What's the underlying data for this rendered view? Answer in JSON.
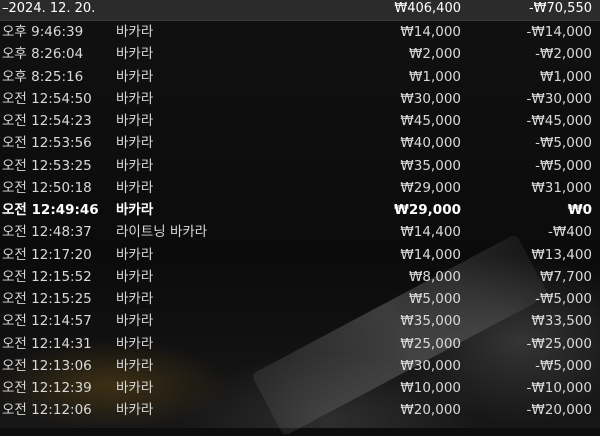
{
  "summary": {
    "date": "–2024. 12. 20.",
    "total_bet": "₩406,400",
    "total_result": "-₩70,550"
  },
  "rows": [
    {
      "time": "오후 9:46:39",
      "game": "바카라",
      "bet": "₩14,000",
      "result": "-₩14,000"
    },
    {
      "time": "오후 8:26:04",
      "game": "바카라",
      "bet": "₩2,000",
      "result": "-₩2,000"
    },
    {
      "time": "오후 8:25:16",
      "game": "바카라",
      "bet": "₩1,000",
      "result": "₩1,000"
    },
    {
      "time": "오전 12:54:50",
      "game": "바카라",
      "bet": "₩30,000",
      "result": "-₩30,000"
    },
    {
      "time": "오전 12:54:23",
      "game": "바카라",
      "bet": "₩45,000",
      "result": "-₩45,000"
    },
    {
      "time": "오전 12:53:56",
      "game": "바카라",
      "bet": "₩40,000",
      "result": "-₩5,000"
    },
    {
      "time": "오전 12:53:25",
      "game": "바카라",
      "bet": "₩35,000",
      "result": "-₩5,000"
    },
    {
      "time": "오전 12:50:18",
      "game": "바카라",
      "bet": "₩29,000",
      "result": "₩31,000"
    },
    {
      "time": "오전 12:49:46",
      "game": "바카라",
      "bet": "₩29,000",
      "result": "₩0",
      "highlight": true
    },
    {
      "time": "오전 12:48:37",
      "game": "라이트닝 바카라",
      "bet": "₩14,400",
      "result": "-₩400"
    },
    {
      "time": "오전 12:17:20",
      "game": "바카라",
      "bet": "₩14,000",
      "result": "₩13,400"
    },
    {
      "time": "오전 12:15:52",
      "game": "바카라",
      "bet": "₩8,000",
      "result": "₩7,700"
    },
    {
      "time": "오전 12:15:25",
      "game": "바카라",
      "bet": "₩5,000",
      "result": "-₩5,000"
    },
    {
      "time": "오전 12:14:57",
      "game": "바카라",
      "bet": "₩35,000",
      "result": "₩33,500"
    },
    {
      "time": "오전 12:14:31",
      "game": "바카라",
      "bet": "₩25,000",
      "result": "-₩25,000"
    },
    {
      "time": "오전 12:13:06",
      "game": "바카라",
      "bet": "₩30,000",
      "result": "-₩5,000"
    },
    {
      "time": "오전 12:12:39",
      "game": "바카라",
      "bet": "₩10,000",
      "result": "-₩10,000"
    },
    {
      "time": "오전 12:12:06",
      "game": "바카라",
      "bet": "₩20,000",
      "result": "-₩20,000"
    }
  ]
}
